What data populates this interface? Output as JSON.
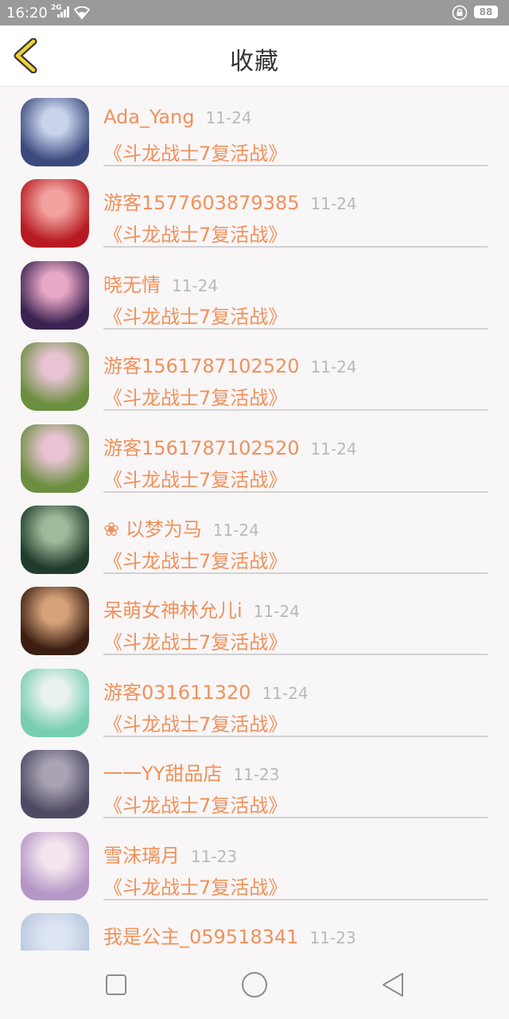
{
  "status": {
    "time": "16:20",
    "network": "2G",
    "battery": "88"
  },
  "header": {
    "title": "收藏"
  },
  "items": [
    {
      "user": "Ada_Yang",
      "date": "11-24",
      "title": "《斗龙战士7复活战》",
      "avatar_colors": [
        "#3b4a7e",
        "#c9d3ec"
      ]
    },
    {
      "user": "游客1577603879385",
      "date": "11-24",
      "title": "《斗龙战士7复活战》",
      "avatar_colors": [
        "#b71a1f",
        "#f2a3a0"
      ]
    },
    {
      "user": "晓无情",
      "date": "11-24",
      "title": "《斗龙战士7复活战》",
      "avatar_colors": [
        "#3a2350",
        "#e8a7c6"
      ]
    },
    {
      "user": "游客1561787102520",
      "date": "11-24",
      "title": "《斗龙战士7复活战》",
      "avatar_colors": [
        "#6b8e3f",
        "#e7c3d3"
      ]
    },
    {
      "user": "游客1561787102520",
      "date": "11-24",
      "title": "《斗龙战士7复活战》",
      "avatar_colors": [
        "#6b8e3f",
        "#e7c3d3"
      ]
    },
    {
      "user": "❀ 以梦为马",
      "date": "11-24",
      "title": "《斗龙战士7复活战》",
      "avatar_colors": [
        "#1f3b2b",
        "#9dbb9a"
      ]
    },
    {
      "user": "呆萌女神林允儿i",
      "date": "11-24",
      "title": "《斗龙战士7复活战》",
      "avatar_colors": [
        "#3b1e12",
        "#d6a27a"
      ]
    },
    {
      "user": "游客031611320",
      "date": "11-24",
      "title": "《斗龙战士7复活战》",
      "avatar_colors": [
        "#76cdb2",
        "#e9f2ee"
      ]
    },
    {
      "user": "一一YY甜品店",
      "date": "11-23",
      "title": "《斗龙战士7复活战》",
      "avatar_colors": [
        "#4f4a63",
        "#a9a3b3"
      ]
    },
    {
      "user": "雪沫璃月",
      "date": "11-23",
      "title": "《斗龙战士7复活战》",
      "avatar_colors": [
        "#b596c6",
        "#f4e6ef"
      ]
    },
    {
      "user": "我是公主_059518341",
      "date": "11-23",
      "title": "",
      "avatar_colors": [
        "#b7c6de",
        "#dde5f2"
      ]
    }
  ]
}
